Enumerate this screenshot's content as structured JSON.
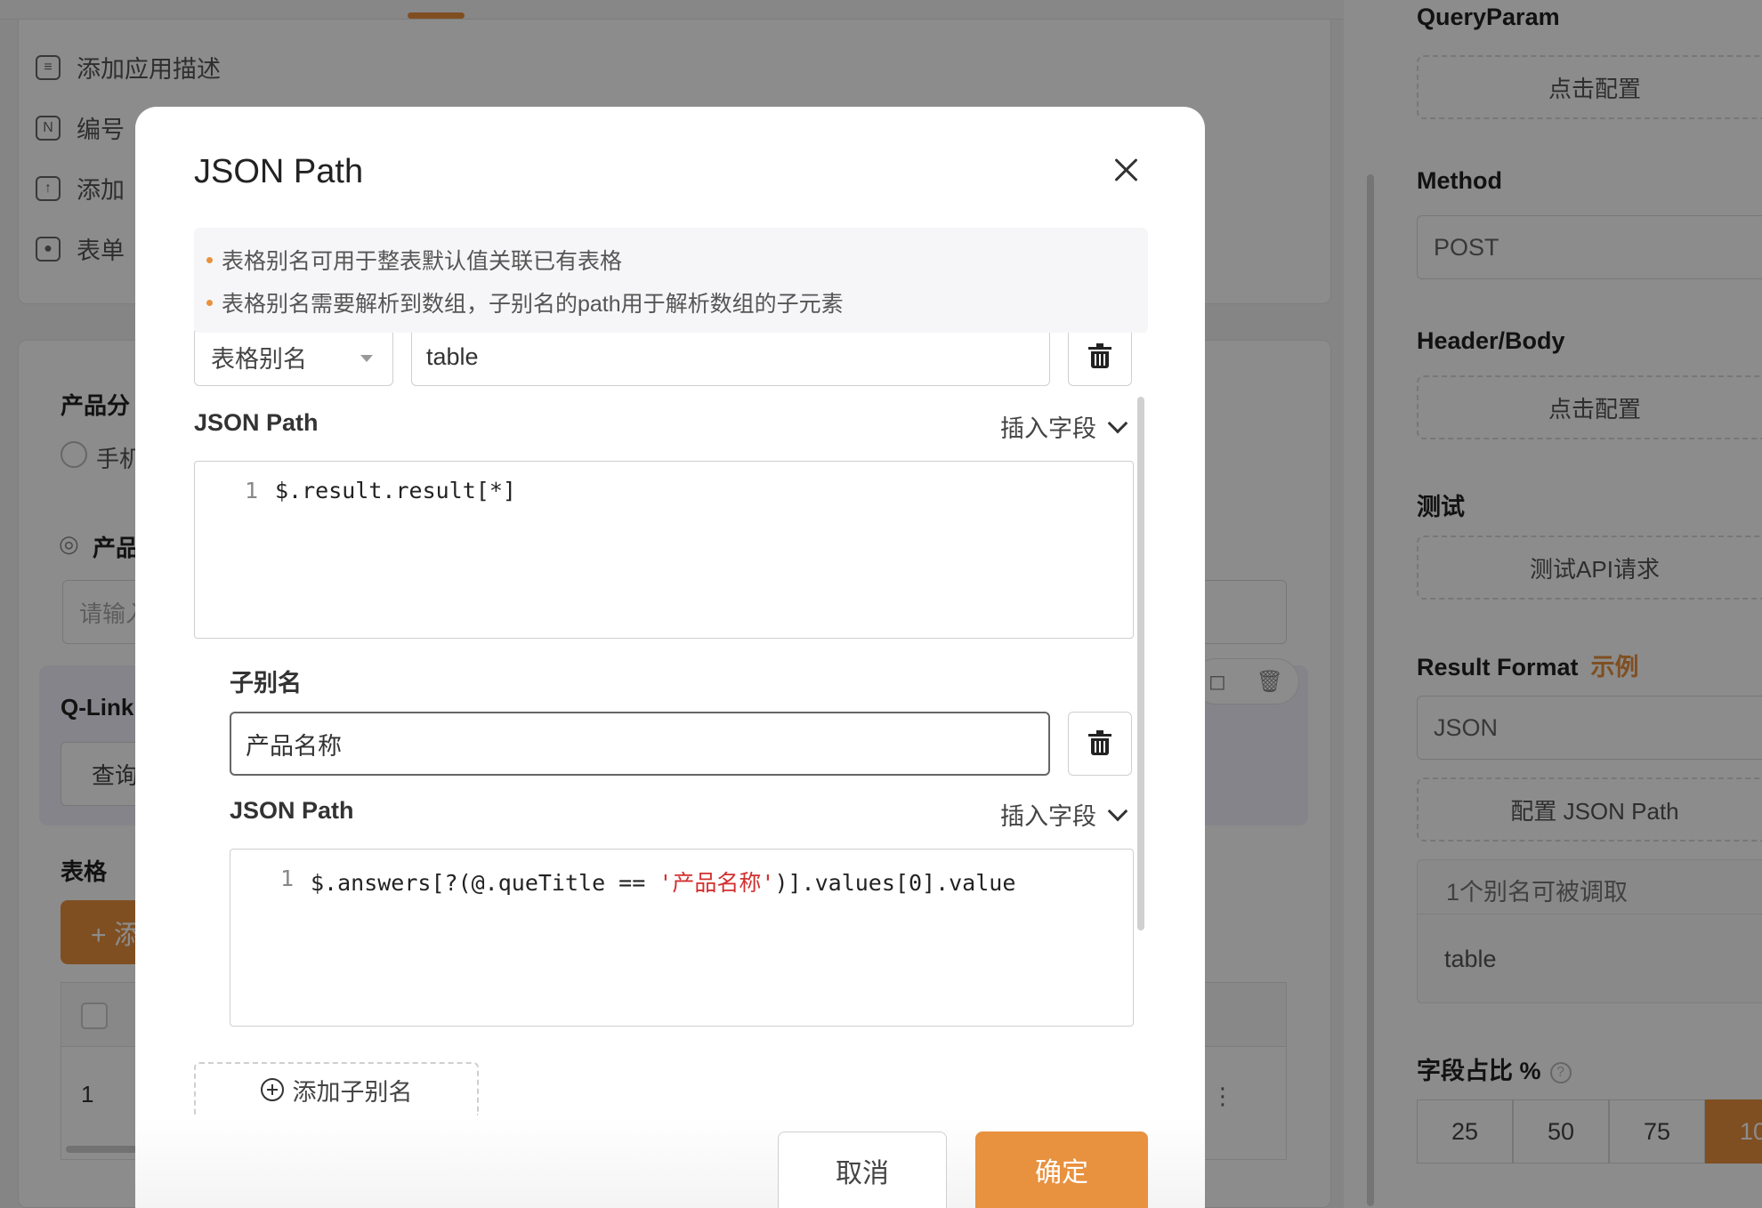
{
  "background": {
    "menu": [
      {
        "icon": "message-icon",
        "label": "添加应用描述"
      },
      {
        "icon": "number-icon",
        "label": "编号"
      },
      {
        "icon": "upload-icon",
        "label": "添加"
      },
      {
        "icon": "palette-icon",
        "label": "表单"
      }
    ],
    "labels": {
      "product_category": "产品分",
      "radio_label": "手机",
      "product_hidden": "产品",
      "input_placeholder": "请输入",
      "qlink": "Q-Link",
      "qlink_query": "查询",
      "table": "表格",
      "add_button": "+ 添",
      "row_number": "1",
      "row_menu": "⋮"
    },
    "right_panel": {
      "queryparam_label": "QueryParam",
      "configure_1": "点击配置",
      "method_label": "Method",
      "method_value": "POST",
      "header_body_label": "Header/Body",
      "configure_2": "点击配置",
      "test_label": "测试",
      "test_button": "测试API请求",
      "result_format_label": "Result Format",
      "example_link": "示例",
      "result_format_value": "JSON",
      "config_jsonpath": "配置 JSON Path",
      "alias_count": "1个别名可被调取",
      "alias_item": "table",
      "field_ratio_label": "字段占比 %",
      "field_ratio_options": [
        "25",
        "50",
        "75",
        "10"
      ],
      "field_ratio_active_index": 3
    }
  },
  "modal": {
    "title": "JSON Path",
    "notice": [
      "表格别名可用于整表默认值关联已有表格",
      "表格别名需要解析到数组，子别名的path用于解析数组的子元素"
    ],
    "alias_type": "表格别名",
    "alias_name": "table",
    "json_path_label": "JSON Path",
    "insert_field": "插入字段",
    "json_path_line_no": "1",
    "json_path_code": "$.result.result[*]",
    "sub_alias_label": "子别名",
    "sub_alias_value": "产品名称",
    "sub_json_path_label": "JSON Path",
    "sub_insert_field": "插入字段",
    "sub_json_path_line_no": "1",
    "sub_code_prefix": "$.answers[?(@.queTitle == ",
    "sub_code_string": "'产品名称'",
    "sub_code_suffix": ")].values[0].value",
    "add_sub_alias": "添加子别名",
    "cancel": "取消",
    "confirm": "确定"
  },
  "colors": {
    "accent": "#e8913f",
    "string_red": "#d32f2f"
  }
}
